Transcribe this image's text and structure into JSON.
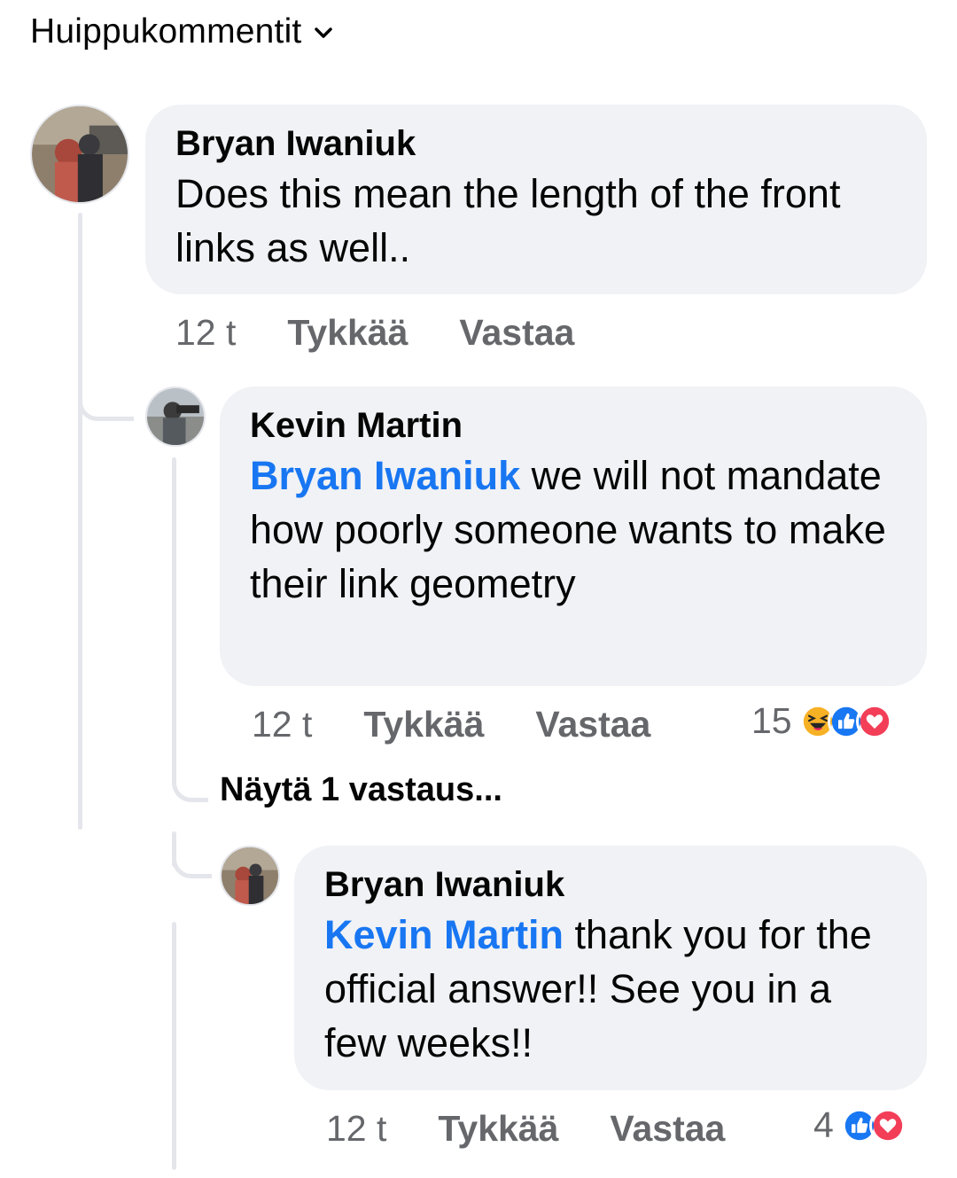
{
  "header": {
    "sort_label": "Huippukommentit"
  },
  "comments": [
    {
      "author": "Bryan Iwaniuk",
      "text": "Does this mean the length of the front links as well..",
      "time": "12 t",
      "like_label": "Tykkää",
      "reply_label": "Vastaa"
    },
    {
      "author": "Kevin Martin",
      "mention": "Bryan Iwaniuk",
      "text": " we will not mandate how poorly someone wants to make their link geometry",
      "time": "12 t",
      "like_label": "Tykkää",
      "reply_label": "Vastaa",
      "reaction_count": "15",
      "reactions": [
        "haha-icon",
        "like-icon",
        "love-icon"
      ]
    },
    {
      "author": "Bryan Iwaniuk",
      "mention": "Kevin Martin",
      "text": " thank you for the official answer!! See you in a few weeks!!",
      "time": "12 t",
      "like_label": "Tykkää",
      "reply_label": "Vastaa",
      "reaction_count": "4",
      "reactions": [
        "like-icon",
        "love-icon"
      ]
    }
  ],
  "view_replies_label": "Näytä 1 vastaus...",
  "colors": {
    "bubble": "#f0f2f5",
    "mention": "#1876f2",
    "like": "#1877f2",
    "love": "#f33e58",
    "haha": "#f7b125",
    "muted_text": "#65676b"
  }
}
